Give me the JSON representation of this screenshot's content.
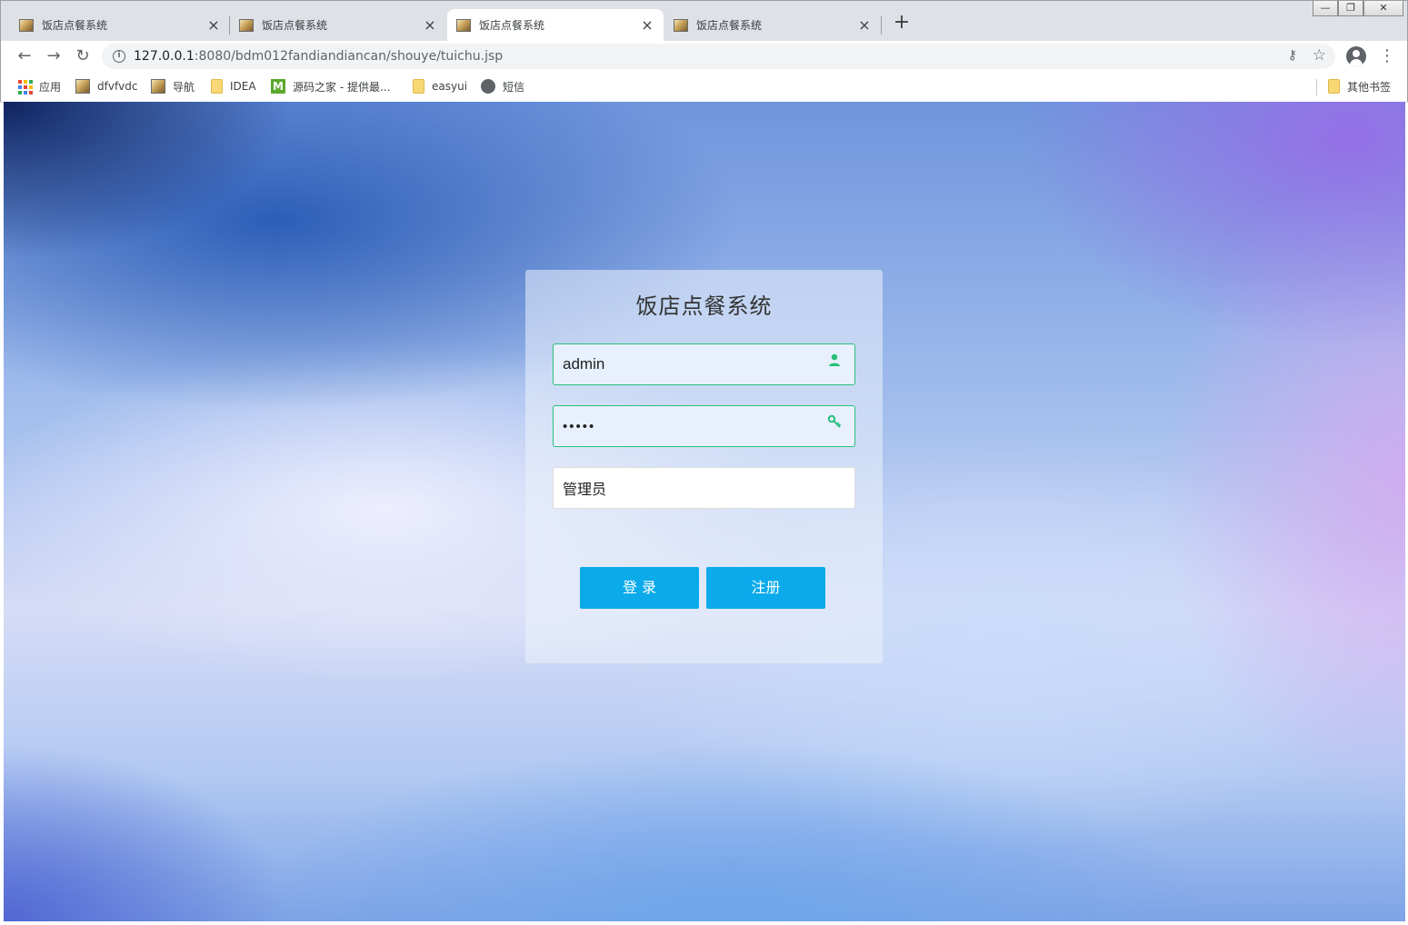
{
  "browser": {
    "tabs": [
      {
        "title": "饭店点餐系统",
        "active": false
      },
      {
        "title": "饭店点餐系统",
        "active": false
      },
      {
        "title": "饭店点餐系统",
        "active": true
      },
      {
        "title": "饭店点餐系统",
        "active": false
      }
    ],
    "new_tab_label": "+",
    "close_label": "×",
    "window_buttons": {
      "minimize": "—",
      "restore": "❐",
      "close": "✕"
    },
    "url_host": "127.0.0.1",
    "url_rest": ":8080/bdm012fandiandiancan/shouye/tuichu.jsp",
    "bookmarks": [
      {
        "label": "应用",
        "icon": "apps-grid-icon"
      },
      {
        "label": "dfvfvdc",
        "icon": "image-icon"
      },
      {
        "label": "导航",
        "icon": "image-icon"
      },
      {
        "label": "IDEA",
        "icon": "folder-icon"
      },
      {
        "label": "源码之家 - 提供最...",
        "icon": "m-logo-icon"
      },
      {
        "label": "easyui",
        "icon": "folder-icon"
      },
      {
        "label": "短信",
        "icon": "globe-icon"
      }
    ],
    "other_bookmarks": "其他书签"
  },
  "login": {
    "title": "饭店点餐系统",
    "username": "admin",
    "password_mask": "•••••",
    "role": "管理员",
    "login_button": "登 录",
    "register_button": "注册"
  },
  "colors": {
    "accent": "#0aaaeb",
    "input_border_active": "#2bbf79",
    "input_fill": "#e8f0fe"
  }
}
